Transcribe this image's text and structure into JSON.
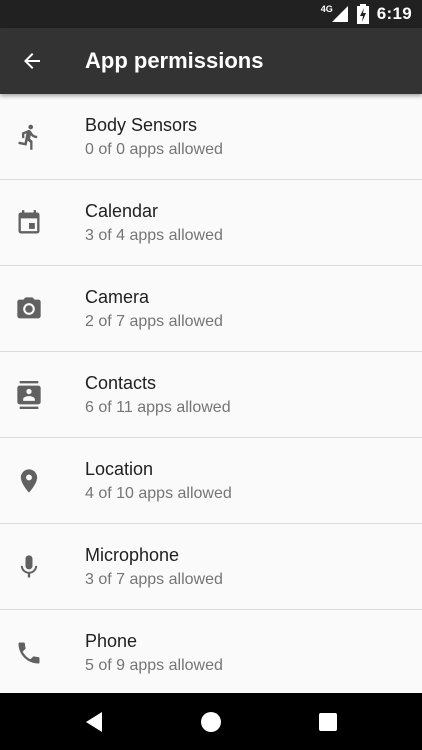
{
  "status_bar": {
    "network": "4G",
    "time": "6:19"
  },
  "toolbar": {
    "title": "App permissions"
  },
  "permissions": [
    {
      "label": "Body Sensors",
      "summary": "0 of 0 apps allowed",
      "icon": "running-person-icon"
    },
    {
      "label": "Calendar",
      "summary": "3 of 4 apps allowed",
      "icon": "calendar-icon"
    },
    {
      "label": "Camera",
      "summary": "2 of 7 apps allowed",
      "icon": "camera-icon"
    },
    {
      "label": "Contacts",
      "summary": "6 of 11 apps allowed",
      "icon": "contacts-icon"
    },
    {
      "label": "Location",
      "summary": "4 of 10 apps allowed",
      "icon": "location-pin-icon"
    },
    {
      "label": "Microphone",
      "summary": "3 of 7 apps allowed",
      "icon": "microphone-icon"
    },
    {
      "label": "Phone",
      "summary": "5 of 9 apps allowed",
      "icon": "phone-icon"
    }
  ],
  "colors": {
    "toolbar": "#333333",
    "status_bar": "#212121",
    "background": "#fafafa",
    "icon": "#616161"
  }
}
